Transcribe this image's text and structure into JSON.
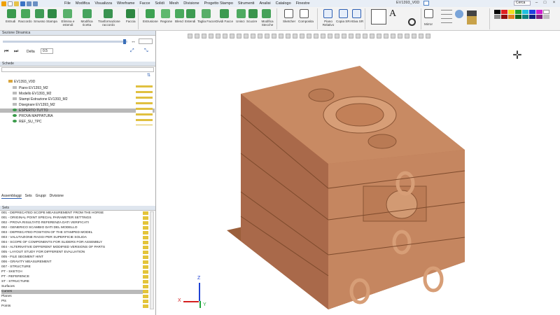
{
  "app": {
    "window_title": "EV1393_V0D"
  },
  "menu": [
    "File",
    "Modifica",
    "Visualizza",
    "Wireframe",
    "Facce",
    "Solidi",
    "Mesh",
    "Divisione",
    "Progetto Stampo",
    "Strumenti",
    "Analisi",
    "Catalogo",
    "Finestre"
  ],
  "search_placeholder": "Cerca",
  "ribbon": [
    "Estrudi",
    "Raccordo",
    "Smusso",
    "Stampa",
    "Elimina e estendi",
    "Modifica ricetta",
    "Trasformazione raccordo",
    "Faccia",
    "Estrusione",
    "Regione",
    "Blend",
    "Estendi",
    "Taglia Facce",
    "Dividi Facce",
    "Unisci",
    "Scucire",
    "Modifica Stecche",
    "Sketcher",
    "Composita",
    "Piano Relativo",
    "Copia SR",
    "Attiva SR",
    "Mirror"
  ],
  "panel": {
    "dynamic_section_title": "Sezione Dinamica",
    "step_label": "Delta",
    "step_value": "0.5",
    "tree_title": "Schede",
    "tree": [
      "EV1393_V0D",
      "Piano EV1393_M2",
      "Modello EV1393_M2",
      "Stampi Estrazione EV1393_M2",
      "Disegnare EV1393_M2",
      "ESPERTO TUTTO",
      "PROVA MAPPATURA",
      "REF_SU_TPC"
    ],
    "tabs": [
      "Assemblaggi",
      "Sets",
      "Gruppi",
      "Divisione"
    ],
    "layers_header": "Sets",
    "layers": [
      "001 - DEPRECATED SCOPE MEASUREMENT FROM THE HORSE",
      "001 - ORIGINAL POINT SPECIAL PARAMETER SETTINGS",
      "002 - PROVA RISULTATO REFERENZA DATI VERIFICATI",
      "002 - GENERICO SCAMBIO DATI DEL MODELLO",
      "003 - DEPRECATED POSITION OF THE STAMPED MODEL",
      "003 - VALUTAZIONE RAGGI PER SUPERFICIE SOLIDA",
      "004 - SCOPE OF COMPONENTS FOR SLIDERS FOR ASSEMBLY",
      "004 - ALTERNATIVE DIFFERENT MODIFIED VERSIONS OF PARTS",
      "005 - LAYOUT STUDY FOR DIFFERENT EVALUATION",
      "005 - FILE SEGMENT HINT",
      "006 - GRAVITY MEASUREMENT",
      "007 - STRUCTURE",
      "PT - SKETCH",
      "PT - REFERENCE",
      "ST - STRUCTURE",
      "Surfaces",
      "Curves",
      "Planes",
      "Pts",
      "Points"
    ]
  },
  "axes": {
    "x": "X",
    "y": "Y",
    "z": "Z"
  },
  "colors": {
    "mold": "#c08561",
    "mold_dark": "#8a5535",
    "mold_light": "#d9a27c"
  }
}
